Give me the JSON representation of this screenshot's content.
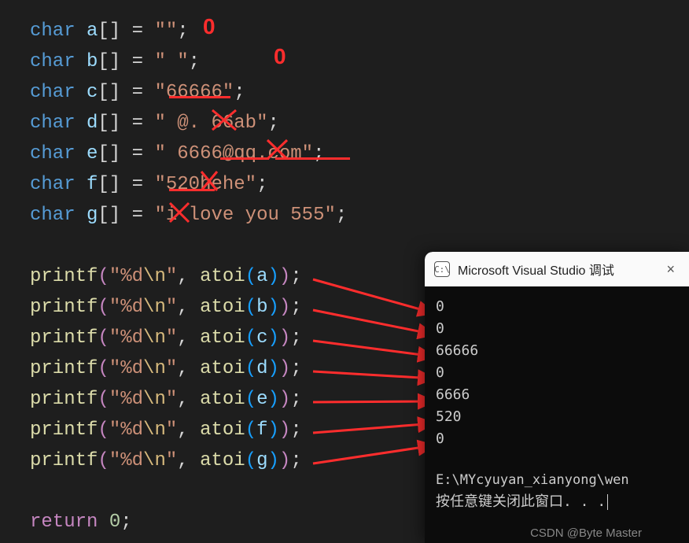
{
  "code": {
    "kw_char": "char",
    "kw_return": "return",
    "arr_a": "a",
    "arr_b": "b",
    "arr_c": "c",
    "arr_d": "d",
    "arr_e": "e",
    "arr_f": "f",
    "arr_g": "g",
    "eq": " = ",
    "brackets": "[]",
    "semi": ";",
    "str_a": "\"\"",
    "str_b": "\"       \"",
    "str_c": "\"66666\"",
    "str_d": "\"    @. 66ab\"",
    "str_e": "\"    6666@qq.com\"",
    "str_f": "\"520hehe\"",
    "str_g": "\"i love you 555\"",
    "printf": "printf",
    "atoi": "atoi",
    "fmt": "\"%d",
    "esc": "\\n",
    "fmt_end": "\"",
    "comma": ", ",
    "ret_val": "0"
  },
  "annotations": {
    "ann_a": "0",
    "ann_b": "0"
  },
  "console": {
    "title": "Microsoft Visual Studio 调试",
    "icon_text": "C:\\",
    "out_0": "0",
    "out_1": "0",
    "out_2": "66666",
    "out_3": "0",
    "out_4": "6666",
    "out_5": "520",
    "out_6": "0",
    "path": "E:\\MYcyuyan_xianyong\\wen",
    "prompt": "按任意键关闭此窗口. . ."
  },
  "watermark": "CSDN @Byte Master"
}
